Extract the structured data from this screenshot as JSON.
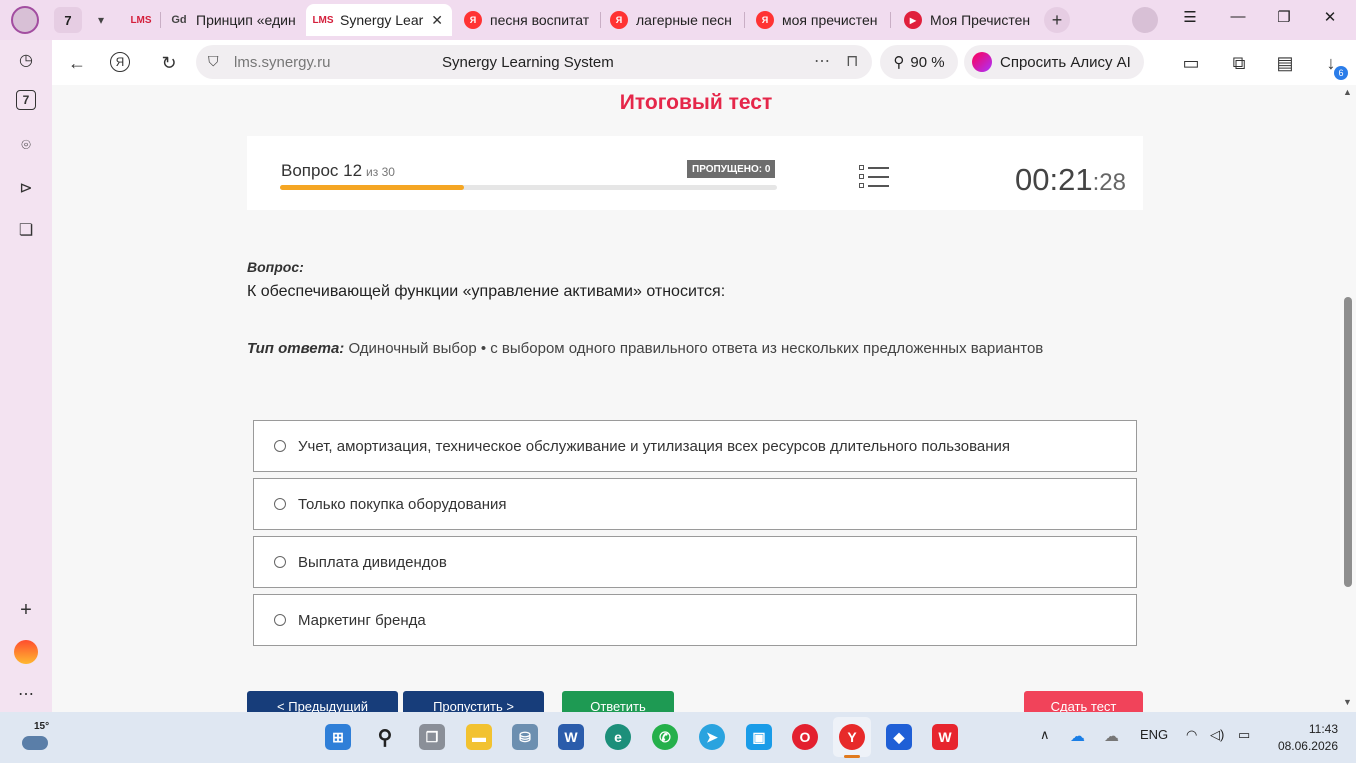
{
  "browser": {
    "tab_count": "7",
    "tabs": [
      {
        "favicon": "LMS",
        "title": ""
      },
      {
        "favicon": "Gd",
        "title": "Принцип «един"
      },
      {
        "favicon": "LMS",
        "title": "Synergy Lear"
      },
      {
        "favicon": "Я",
        "title": "песня воспитат"
      },
      {
        "favicon": "Я",
        "title": "лагерные песн"
      },
      {
        "favicon": "Я",
        "title": "моя пречистен"
      },
      {
        "favicon": "▶",
        "title": "Моя Пречистен"
      }
    ],
    "address": {
      "url": "lms.synergy.ru",
      "page_title": "Synergy Learning System"
    },
    "zoom": "90 %",
    "alice_label": "Спросить Алису AI",
    "downloads_count": "6",
    "sidebar_badge": "7"
  },
  "page": {
    "test_title": "Итоговый тест",
    "status": {
      "question_label": "Вопрос 12",
      "question_of": "из 30",
      "progress_fraction": 0.37,
      "skipped_label": "ПРОПУЩЕНО: 0",
      "timer_main": "00:21",
      "timer_seconds": ":28"
    },
    "question_heading": "Вопрос:",
    "question_text": "К обеспечивающей функции «управление активами» относится:",
    "answer_type_label": "Тип ответа:",
    "answer_type_value": " Одиночный выбор • с выбором одного правильного ответа из нескольких предложенных вариантов",
    "options": [
      "Учет, амортизация, техническое обслуживание и утилизация всех ресурсов длительного пользования",
      "Только покупка оборудования",
      "Выплата дивидендов",
      "Маркетинг бренда"
    ],
    "buttons": {
      "prev": "< Предыдущий",
      "skip": "Пропустить >",
      "answer": "Ответить",
      "submit": "Сдать тест"
    }
  },
  "taskbar": {
    "weather_temp": "15°",
    "language": "ENG",
    "time": "11:43",
    "date": "08.06.2026"
  },
  "colors": {
    "accent_title": "#e5274a",
    "progress": "#f5a623",
    "nav_button": "#173d7a",
    "answer_button": "#1e9a53",
    "submit_button": "#f1435a"
  }
}
